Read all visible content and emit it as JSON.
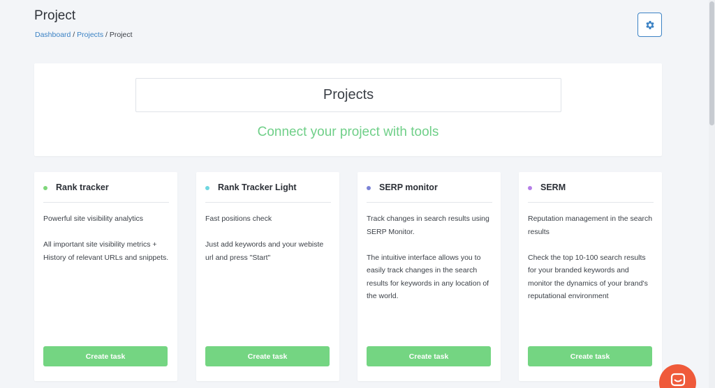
{
  "header": {
    "title": "Project",
    "breadcrumb": {
      "dashboard": "Dashboard",
      "projects": "Projects",
      "current": "Project",
      "separator": " / "
    }
  },
  "hero": {
    "title": "Projects",
    "subtitle": "Connect your project with tools"
  },
  "cards": [
    {
      "title": "Rank tracker",
      "dot_color": "#7ed67a",
      "paragraphs": [
        "Powerful site visibility analytics",
        "All important site visibility metrics + History of relevant URLs and snippets."
      ],
      "button": "Create task"
    },
    {
      "title": "Rank Tracker Light",
      "dot_color": "#6fd6e0",
      "paragraphs": [
        "Fast positions check",
        "Just add keywords and your webiste url and press \"Start\""
      ],
      "button": "Create task"
    },
    {
      "title": "SERP monitor",
      "dot_color": "#7b83d6",
      "paragraphs": [
        "Track changes in search results using SERP Monitor.",
        "The intuitive interface allows you to easily track changes in the search results for keywords in any location of the world."
      ],
      "button": "Create task"
    },
    {
      "title": "SERM",
      "dot_color": "#b57ee8",
      "paragraphs": [
        "Reputation management in the search results",
        "Check the top 10-100 search results for your branded keywords and monitor the dynamics of your brand's reputational environment"
      ],
      "button": "Create task"
    }
  ],
  "icons": {
    "settings": "gear-icon",
    "chat": "chat-icon"
  },
  "colors": {
    "accent": "#3b82c4",
    "green": "#74d582",
    "chat": "#ef5a3a"
  }
}
